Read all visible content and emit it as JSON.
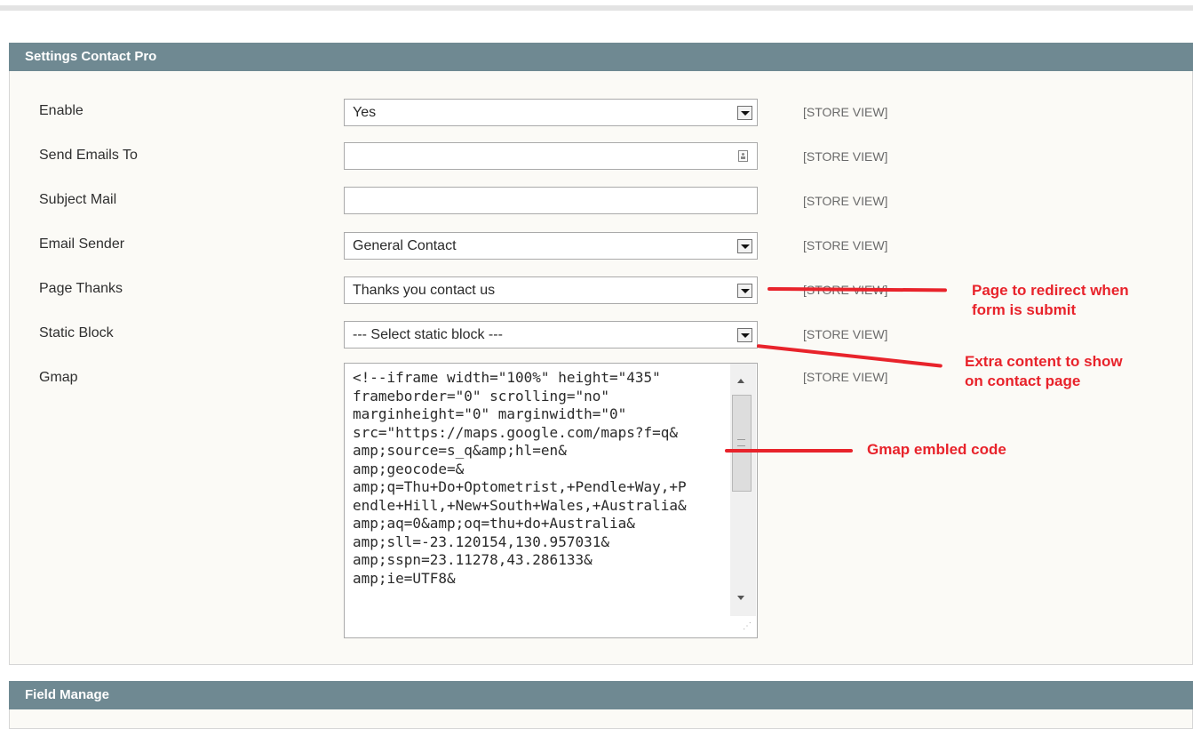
{
  "sections": {
    "settings_title": "Settings Contact Pro",
    "field_manage_title": "Field Manage"
  },
  "fields": {
    "enable": {
      "label": "Enable",
      "value": "Yes",
      "scope": "[STORE VIEW]"
    },
    "send_emails_to": {
      "label": "Send Emails To",
      "value": "",
      "scope": "[STORE VIEW]"
    },
    "subject_mail": {
      "label": "Subject Mail",
      "value": "",
      "scope": "[STORE VIEW]"
    },
    "email_sender": {
      "label": "Email Sender",
      "value": "General Contact",
      "scope": "[STORE VIEW]"
    },
    "page_thanks": {
      "label": "Page Thanks",
      "value": "Thanks you contact us",
      "scope": "[STORE VIEW]"
    },
    "static_block": {
      "label": "Static Block",
      "value": "--- Select static block ---",
      "scope": "[STORE VIEW]"
    },
    "gmap": {
      "label": "Gmap",
      "value": "<!--iframe width=\"100%\" height=\"435\"\nframeborder=\"0\" scrolling=\"no\"\nmarginheight=\"0\" marginwidth=\"0\"\nsrc=\"https://maps.google.com/maps?f=q&\namp;source=s_q&amp;hl=en&\namp;geocode=&\namp;q=Thu+Do+Optometrist,+Pendle+Way,+P\nendle+Hill,+New+South+Wales,+Australia&\namp;aq=0&amp;oq=thu+do+Australia&\namp;sll=-23.120154,130.957031&\namp;sspn=23.11278,43.286133&\namp;ie=UTF8&",
      "scope": "[STORE VIEW]"
    }
  },
  "annotations": {
    "page_thanks": "Page to redirect when\nform is submit",
    "static_block": "Extra content to show\non contact page",
    "gmap": "Gmap embled code"
  },
  "colors": {
    "section_header": "#6f8992",
    "annotation": "#e8232b",
    "scope_text": "#6a6a6a"
  }
}
